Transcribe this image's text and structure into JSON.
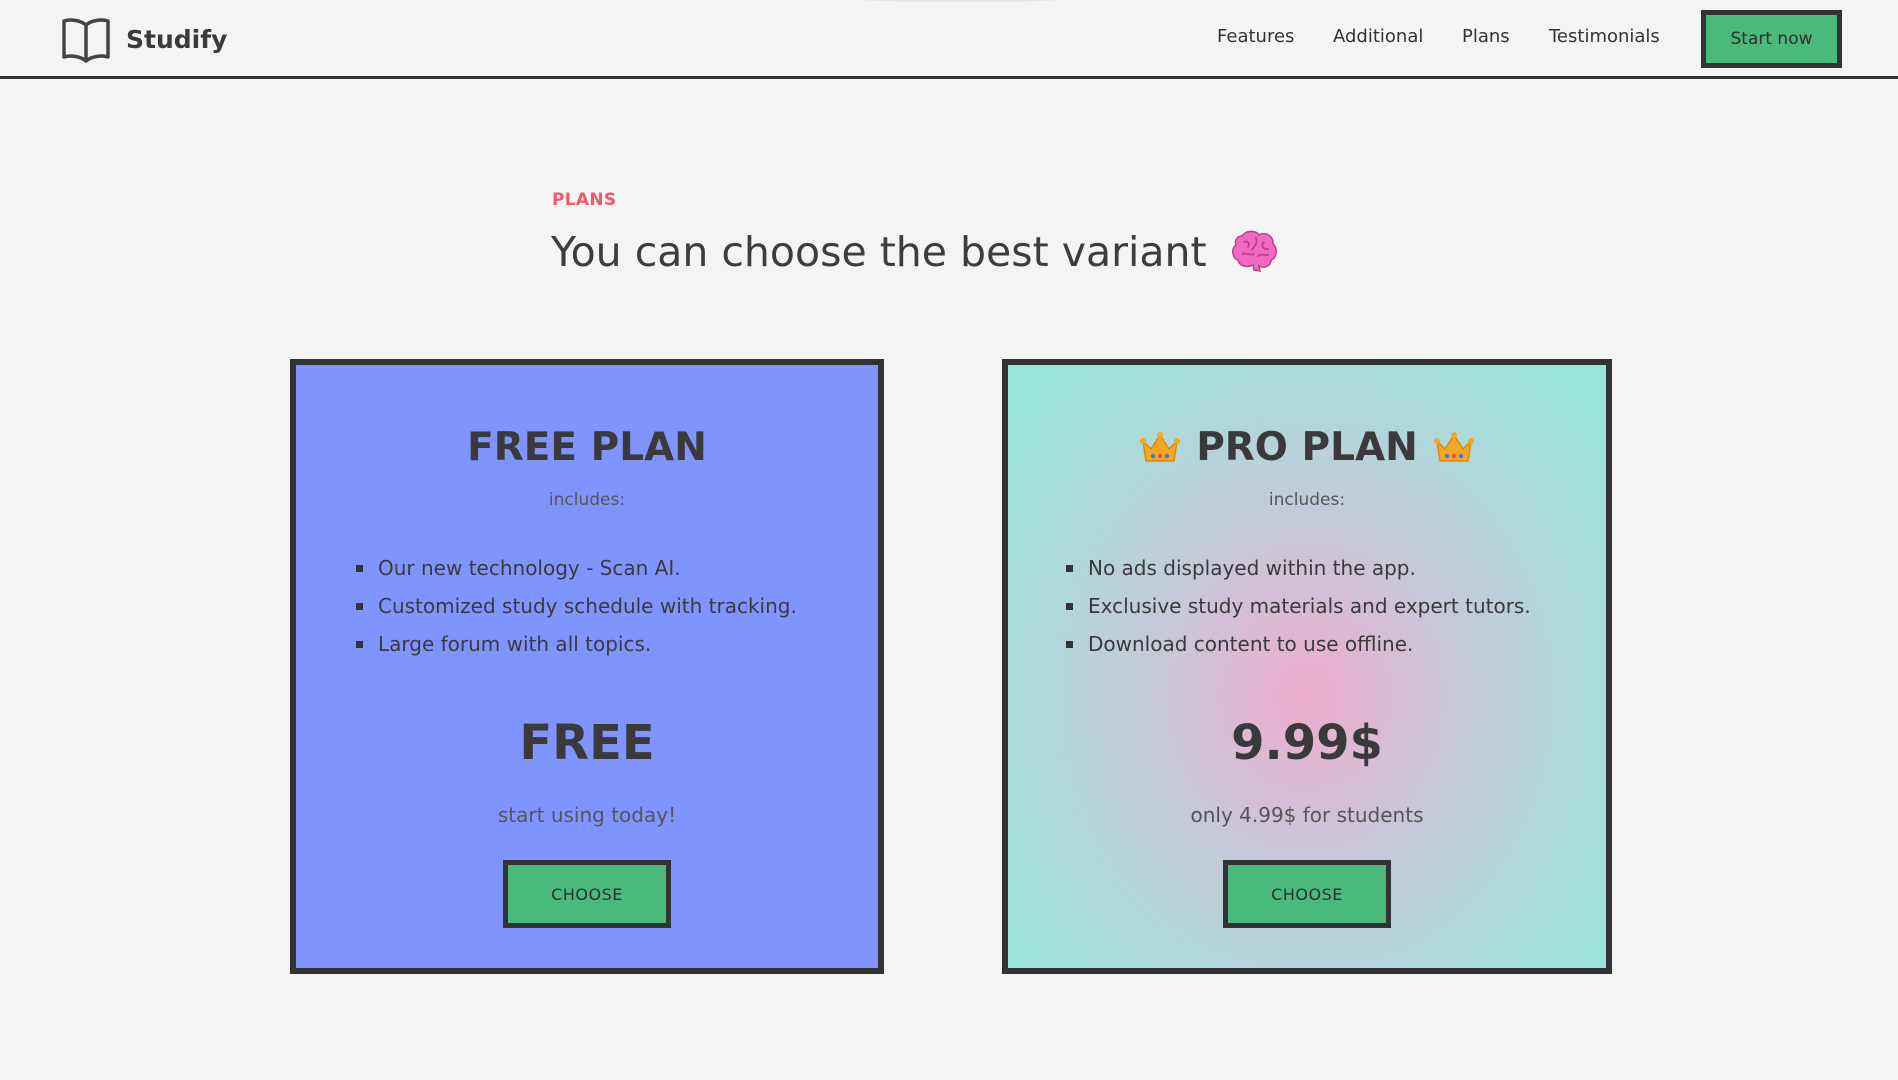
{
  "header": {
    "brand_name": "Studify",
    "nav": [
      "Features",
      "Additional",
      "Plans",
      "Testimonials"
    ],
    "cta_label": "Start now"
  },
  "section": {
    "eyebrow": "PLANS",
    "title": "You can choose the best variant"
  },
  "plans": [
    {
      "name": "FREE PLAN",
      "includes": "includes:",
      "features": [
        "Our new technology - Scan AI.",
        "Customized study schedule with tracking.",
        "Large forum with all topics."
      ],
      "price": "FREE",
      "price_note": "start using today!",
      "button": "CHOOSE"
    },
    {
      "name": "PRO PLAN",
      "includes": "includes:",
      "features": [
        "No ads displayed within the app.",
        "Exclusive study materials and expert tutors.",
        "Download content to use offline."
      ],
      "price": "9.99$",
      "price_note": "only 4.99$ for students",
      "button": "CHOOSE"
    }
  ],
  "icons": {
    "brand": "open-book-icon",
    "title_emoji": "brain-icon",
    "pro_decoration": "crown-icon"
  },
  "colors": {
    "accent_green": "#4aba7a",
    "eyebrow_red": "#ef5b69",
    "free_card": "#8094ff",
    "pro_card_edge": "#96e7da",
    "pro_card_center": "#efaccd"
  }
}
